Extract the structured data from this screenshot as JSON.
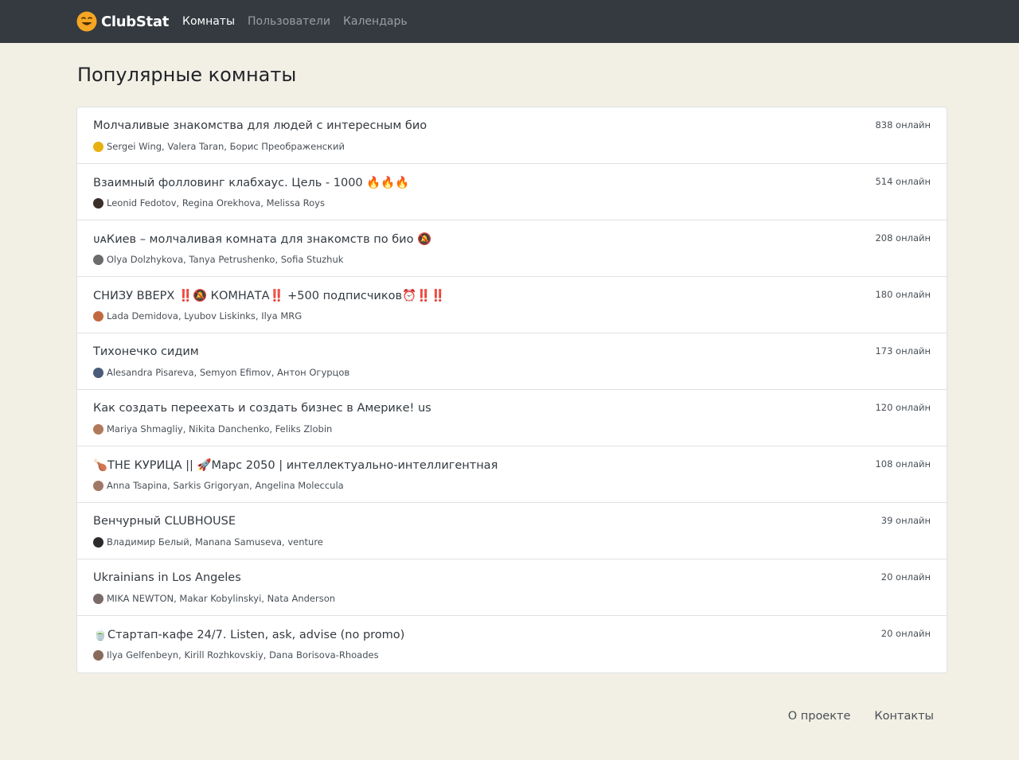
{
  "brand": {
    "name": "ClubStat",
    "icon": "smiley-face-icon",
    "icon_color": "#f6a623"
  },
  "nav": [
    {
      "label": "Комнаты",
      "active": true
    },
    {
      "label": "Пользователи",
      "active": false
    },
    {
      "label": "Календарь",
      "active": false
    }
  ],
  "page_title": "Популярные комнаты",
  "rooms": [
    {
      "title": "Молчаливые знакомства для людей с интересным био",
      "online": "838 онлайн",
      "users": "Sergei Wing, Valera Taran, Борис Преображенский",
      "avatar_color": "#e8b10f"
    },
    {
      "title": "Взаимный фолловинг клабхаус. Цель - 1000 🔥🔥🔥",
      "online": "514 онлайн",
      "users": "Leonid Fedotov, Regina Orekhova, Melissa Roys",
      "avatar_color": "#3a2f2a"
    },
    {
      "title": "ᴜᴀКиев – молчаливая комната для знакомств по био 🔕",
      "online": "208 онлайн",
      "users": "Olya Dolzhykova, Tanya Petrushenko, Sofia Stuzhuk",
      "avatar_color": "#6b6b6b"
    },
    {
      "title": "СНИЗУ ВВЕРХ ‼️🔕 КОМНАТА‼️ +500 подписчиков⏰‼️‼️",
      "online": "180 онлайн",
      "users": "Lada Demidova, Lyubov Liskinks, Ilya MRG",
      "avatar_color": "#c26a3f"
    },
    {
      "title": "Тихонечко сидим",
      "online": "173 онлайн",
      "users": "Alesandra Pisareva, Semyon Efimov, Антон Огурцов",
      "avatar_color": "#4a5a7a"
    },
    {
      "title": "Как создать переехать и создать бизнес в Америке! us",
      "online": "120 онлайн",
      "users": "Mariya Shmagliy, Nikita Danchenko, Feliks Zlobin",
      "avatar_color": "#b07a5a"
    },
    {
      "title": "🍗THE КУРИЦА || 🚀Марс 2050 | интеллектуально-интеллигентная",
      "online": "108 онлайн",
      "users": "Anna Tsapina, Sarkis Grigoryan, Angelina Moleccula",
      "avatar_color": "#a07868"
    },
    {
      "title": "Венчурный CLUBHOUSE",
      "online": "39 онлайн",
      "users": "Владимир Белый, Manana Samuseva, venture",
      "avatar_color": "#2b2b2b"
    },
    {
      "title": "Ukrainians in Los Angeles",
      "online": "20 онлайн",
      "users": "MIKA NEWTON, Makar Kobylinskyi, Nata Anderson",
      "avatar_color": "#7a6a6a"
    },
    {
      "title": "🍵Стартап-кафе 24/7. Listen, ask, advise (no promo)",
      "online": "20 онлайн",
      "users": "Ilya Gelfenbeyn, Kirill Rozhkovskiy, Dana Borisova-Rhoades",
      "avatar_color": "#8a6a5a"
    }
  ],
  "footer": {
    "about": "О проекте",
    "contacts": "Контакты"
  }
}
